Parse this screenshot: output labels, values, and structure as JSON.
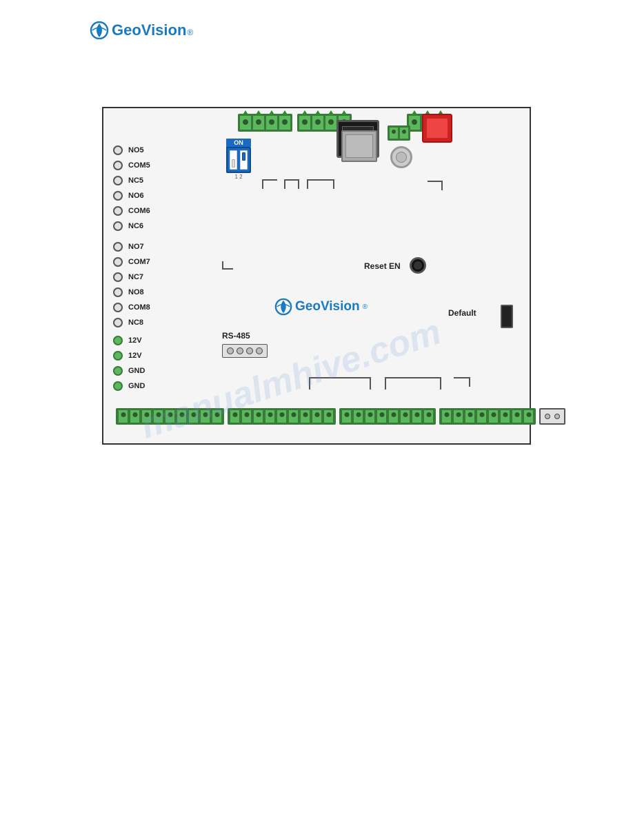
{
  "logo": {
    "text": "GeoVision",
    "superscript": "®"
  },
  "board": {
    "terminals_left": [
      {
        "label": "NO5",
        "type": "circle"
      },
      {
        "label": "COM5",
        "type": "circle"
      },
      {
        "label": "NC5",
        "type": "circle"
      },
      {
        "label": "NO6",
        "type": "circle"
      },
      {
        "label": "COM6",
        "type": "circle"
      },
      {
        "label": "NC6",
        "type": "circle"
      },
      {
        "label": "NO7",
        "type": "circle"
      },
      {
        "label": "COM7",
        "type": "circle"
      },
      {
        "label": "NC7",
        "type": "circle"
      },
      {
        "label": "NO8",
        "type": "circle"
      },
      {
        "label": "COM8",
        "type": "circle"
      },
      {
        "label": "NC8",
        "type": "circle"
      },
      {
        "label": "12V",
        "type": "green"
      },
      {
        "label": "12V",
        "type": "green"
      },
      {
        "label": "GND",
        "type": "green"
      },
      {
        "label": "GND",
        "type": "green"
      }
    ],
    "dip_switch_label": "ON",
    "rs485_label": "RS-485",
    "reset_en_label": "Reset EN",
    "default_label": "Default",
    "board_logo": "GeoVision",
    "board_logo_superscript": "®"
  },
  "watermark": {
    "text": "manualmhive.com"
  }
}
